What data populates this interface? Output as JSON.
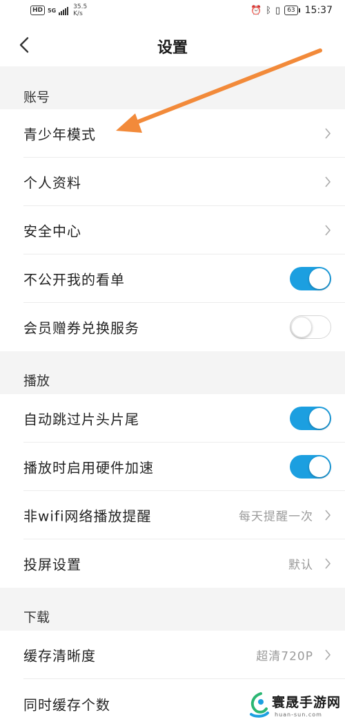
{
  "status_bar": {
    "hd": "HD",
    "network": "5G",
    "speed_value": "35.5",
    "speed_unit": "K/s",
    "battery": "63",
    "time": "15:37"
  },
  "nav": {
    "title": "设置"
  },
  "sections": {
    "account": {
      "header": "账号"
    },
    "playback": {
      "header": "播放"
    },
    "download": {
      "header": "下载"
    }
  },
  "rows": {
    "youth_mode": {
      "label": "青少年模式"
    },
    "profile": {
      "label": "个人资料"
    },
    "security": {
      "label": "安全中心"
    },
    "private_list": {
      "label": "不公开我的看单",
      "toggle": true
    },
    "vip_coupon": {
      "label": "会员赠券兑换服务",
      "toggle": false
    },
    "skip_intro": {
      "label": "自动跳过片头片尾",
      "toggle": true
    },
    "hw_accel": {
      "label": "播放时启用硬件加速",
      "toggle": true
    },
    "non_wifi": {
      "label": "非wifi网络播放提醒",
      "value": "每天提醒一次"
    },
    "cast": {
      "label": "投屏设置",
      "value": "默认"
    },
    "cache_quality": {
      "label": "缓存清晰度",
      "value": "超清720P"
    },
    "concurrent_cache": {
      "label": "同时缓存个数"
    }
  },
  "watermark": {
    "name": "寰晟手游网",
    "url": "huan-sun.com"
  },
  "colors": {
    "toggle_on": "#1c9fe0",
    "annotation_arrow": "#f28a3a"
  }
}
